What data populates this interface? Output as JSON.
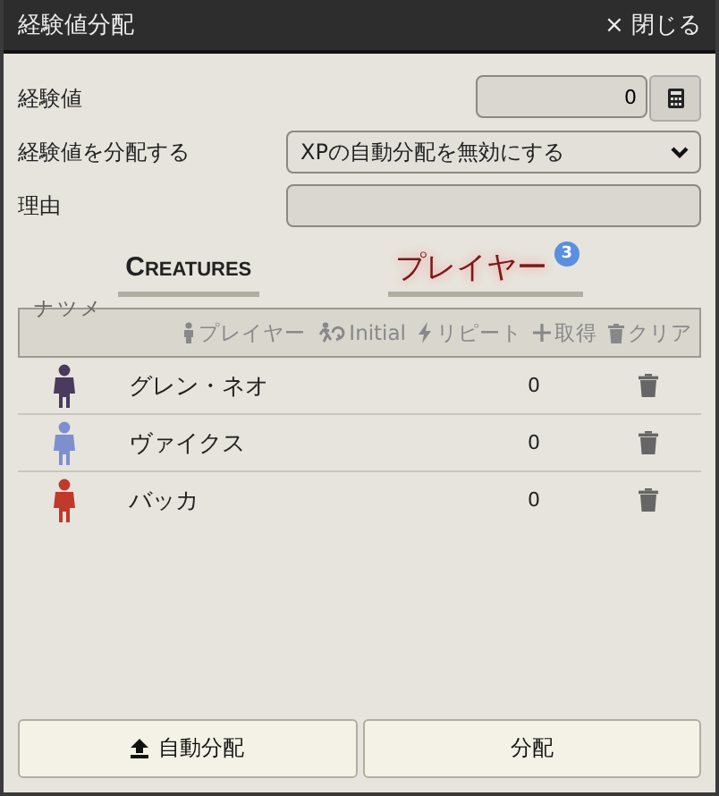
{
  "window": {
    "title": "経験値分配",
    "close": "× 閉じる"
  },
  "xp": {
    "label": "経験値",
    "value": "0"
  },
  "distribute": {
    "label": "経験値を分配する",
    "value": "XPの自動分配を無効にする"
  },
  "reason": {
    "label": "理由"
  },
  "tabs": [
    {
      "label": "Creatures",
      "selected": false
    },
    {
      "label": "プレイヤー",
      "selected": true,
      "badge": "3"
    }
  ],
  "toolbar": {
    "cut_label": "ナツメ",
    "actions": [
      {
        "kind": "player",
        "label": "プレイヤー"
      },
      {
        "kind": "initial",
        "label": "Initial"
      },
      {
        "kind": "repeat",
        "label": "リピート"
      },
      {
        "kind": "add",
        "label": "取得"
      },
      {
        "kind": "clear",
        "label": "クリア"
      }
    ]
  },
  "players": [
    {
      "name": "グレン・ネオ",
      "xp": "0",
      "color": "#4a3a5c"
    },
    {
      "name": "ヴァイクス",
      "xp": "0",
      "color": "#7d8fcf"
    },
    {
      "name": "バッカ",
      "xp": "0",
      "color": "#c0392b"
    }
  ],
  "buttons": [
    {
      "kind": "auto",
      "label": "自動分配"
    },
    {
      "kind": "plain",
      "label": "分配"
    }
  ]
}
